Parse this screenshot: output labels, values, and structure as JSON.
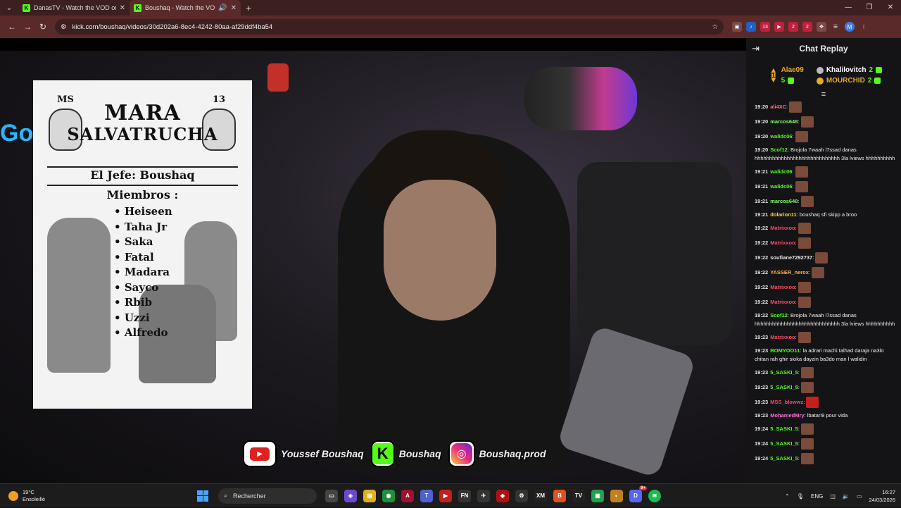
{
  "browser": {
    "tabs": [
      {
        "title": "DanasTV - Watch the VOD on K",
        "active": false
      },
      {
        "title": "Boushaq - Watch the VOD o",
        "active": true
      }
    ],
    "url": "kick.com/boushaq/videos/30d202a6-8ec4-4242-80aa-af29ddf4ba54",
    "extension_badges": [
      "13",
      "2",
      "2"
    ],
    "profile_initial": "M"
  },
  "poster": {
    "ms_left": "MS",
    "ms_right": "13",
    "title_line1": "MARA",
    "title_line2": "SALVATRUCHA",
    "jefe": "El Jefe: Boushaq",
    "miembros_label": "Miembros :",
    "members": [
      "Heiseen",
      "Taha Jr",
      "Saka",
      "Fatal",
      "Madara",
      "Sayco",
      "Rbib",
      "Uzzi",
      "Alfredo"
    ]
  },
  "social": {
    "youtube": "Youssef Boushaq",
    "kick": "Boushaq",
    "instagram": "Boushaq.prod"
  },
  "chat": {
    "title": "Chat Replay",
    "leaderboard": {
      "first": {
        "rank": "1",
        "name": "Alae09",
        "count": "5"
      },
      "others": [
        {
          "name": "Khalilovitch",
          "count": "2"
        },
        {
          "name": "MOURCHID",
          "count": "2"
        }
      ]
    },
    "messages": [
      {
        "ts": "19:20",
        "user": "ali4XC",
        "color": "#ff6b8a",
        "text": "",
        "emote": true
      },
      {
        "ts": "19:20",
        "user": "marcos648",
        "color": "#7dff5a",
        "text": "",
        "emote": true
      },
      {
        "ts": "19:20",
        "user": "walidc06",
        "color": "#53fc18",
        "text": "",
        "emote": true
      },
      {
        "ts": "19:20",
        "user": "Scof12",
        "color": "#53fc18",
        "text": "Brojola 7waah l7ssad danas hhhhhhhhhhhhhhhhhhhhhhhhhhhhh 3la lviews hhhhhhhhhh",
        "emote": false
      },
      {
        "ts": "19:21",
        "user": "walidc06",
        "color": "#53fc18",
        "text": "",
        "emote": true
      },
      {
        "ts": "19:21",
        "user": "walidc06",
        "color": "#53fc18",
        "text": "",
        "emote": true
      },
      {
        "ts": "19:21",
        "user": "marcos648",
        "color": "#7dff5a",
        "text": "",
        "emote": true
      },
      {
        "ts": "19:21",
        "user": "dolarion11",
        "color": "#ffd23a",
        "text": "boushaq sfi skipp a broo",
        "emote": false
      },
      {
        "ts": "19:22",
        "user": "Matrixxoo",
        "color": "#ff4a6a",
        "text": "",
        "emote": true
      },
      {
        "ts": "19:22",
        "user": "Matrixxoo",
        "color": "#ff4a6a",
        "text": "",
        "emote": true
      },
      {
        "ts": "19:22",
        "user": "soufiane7292737",
        "color": "#e8e8e8",
        "text": "",
        "emote": true
      },
      {
        "ts": "19:22",
        "user": "YASSER_nerox",
        "color": "#ffb347",
        "text": "",
        "emote": true
      },
      {
        "ts": "19:22",
        "user": "Matrixxoo",
        "color": "#ff4a6a",
        "text": "",
        "emote": true
      },
      {
        "ts": "19:22",
        "user": "Matrixxoo",
        "color": "#ff4a6a",
        "text": "",
        "emote": true
      },
      {
        "ts": "19:22",
        "user": "Scof12",
        "color": "#53fc18",
        "text": "Brojola 7waah l7ssad danas hhhhhhhhhhhhhhhhhhhhhhhhhhhhh 3la lviews hhhhhhhhhh",
        "emote": false
      },
      {
        "ts": "19:23",
        "user": "Matrixxoo",
        "color": "#ff4a6a",
        "text": "",
        "emote": true
      },
      {
        "ts": "19:23",
        "user": "BOMYOO11",
        "color": "#53fc18",
        "text": "la adrari machi talhad daraja na3lo chitan rah ghir sioka dayzin ba3do man l walidin",
        "emote": false
      },
      {
        "ts": "19:23",
        "user": "5_SASKI_5",
        "color": "#53fc18",
        "text": "",
        "emote": true
      },
      {
        "ts": "19:23",
        "user": "5_SASKI_5",
        "color": "#53fc18",
        "text": "",
        "emote": true
      },
      {
        "ts": "19:23",
        "user": "MSS_blowwz",
        "color": "#ff4a6a",
        "text": "",
        "emote": true,
        "red": true
      },
      {
        "ts": "19:23",
        "user": "MohamedMry",
        "color": "#ff6bd5",
        "text": "lbatari9 pour vida",
        "emote": false
      },
      {
        "ts": "19:24",
        "user": "5_SASKI_5",
        "color": "#53fc18",
        "text": "",
        "emote": true
      },
      {
        "ts": "19:24",
        "user": "5_SASKI_5",
        "color": "#53fc18",
        "text": "",
        "emote": true
      },
      {
        "ts": "19:24",
        "user": "5_SASKI_5",
        "color": "#53fc18",
        "text": "",
        "emote": true
      }
    ]
  },
  "taskbar": {
    "weather_temp": "19°C",
    "weather_desc": "Ensoleillé",
    "search_placeholder": "Rechercher",
    "lang": "ENG",
    "time": "16:27",
    "date": "24/03/2026",
    "discord_badge": "9+"
  }
}
